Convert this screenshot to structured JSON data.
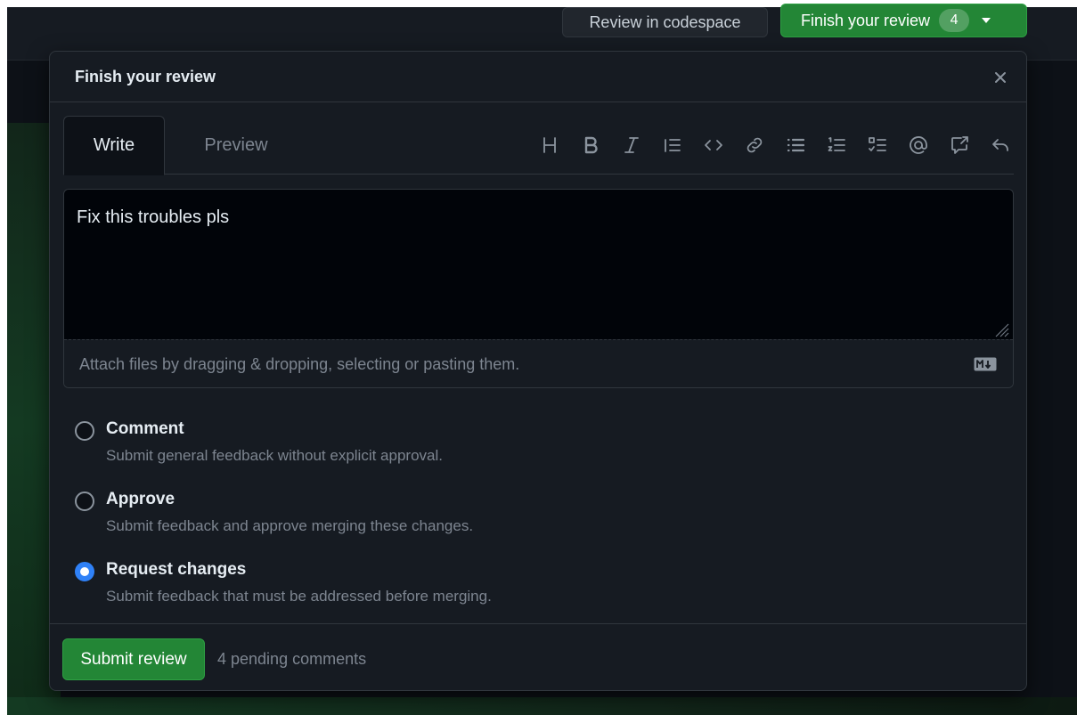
{
  "header": {
    "codespace_label": "Review in codespace",
    "finish_label": "Finish your review",
    "finish_count": "4"
  },
  "dialog": {
    "title": "Finish your review",
    "tabs": [
      {
        "label": "Write",
        "active": true
      },
      {
        "label": "Preview",
        "active": false
      }
    ],
    "toolbar": [
      "heading-icon",
      "bold-icon",
      "italic-icon",
      "quote-icon",
      "code-icon",
      "link-icon",
      "unordered-list-icon",
      "ordered-list-icon",
      "task-list-icon",
      "mention-icon",
      "cross-reference-icon",
      "reply-icon"
    ],
    "editor": {
      "value": "Fix this troubles pls",
      "attach_hint": "Attach files by dragging & dropping, selecting or pasting them."
    },
    "options": [
      {
        "label": "Comment",
        "description": "Submit general feedback without explicit approval.",
        "checked": false
      },
      {
        "label": "Approve",
        "description": "Submit feedback and approve merging these changes.",
        "checked": false
      },
      {
        "label": "Request changes",
        "description": "Submit feedback that must be addressed before merging.",
        "checked": true
      }
    ],
    "submit_label": "Submit review",
    "pending_text": "4 pending comments"
  },
  "colors": {
    "accent_green": "#238636",
    "radio_blue": "#2f81f7",
    "background": "#0d1117",
    "dialog_bg": "#161b22"
  }
}
